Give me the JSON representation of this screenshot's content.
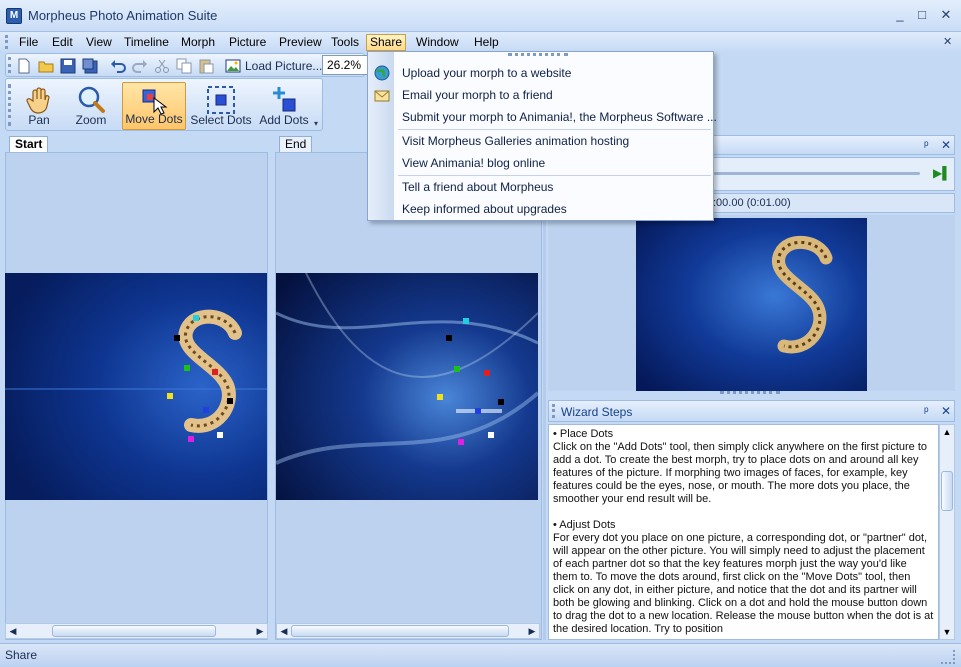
{
  "app": {
    "title": "Morpheus Photo Animation Suite",
    "window_minimize": "_",
    "window_restore": "□",
    "window_close": "✕"
  },
  "menubar": {
    "items": [
      "File",
      "Edit",
      "View",
      "Timeline",
      "Morph",
      "Picture",
      "Preview",
      "Tools",
      "Share",
      "Window",
      "Help"
    ],
    "active": "Share",
    "right_close": "✕"
  },
  "toolbar": {
    "load_picture_label": "Load Picture...",
    "zoom_value": "26.2%"
  },
  "tools": {
    "items": [
      "Pan",
      "Zoom",
      "Move Dots",
      "Select Dots",
      "Add Dots"
    ],
    "active": "Move Dots"
  },
  "start_panel": {
    "tab_label": "Start"
  },
  "end_panel": {
    "tab_label": "End"
  },
  "preview_panel": {
    "time_readout": ":00.00 (0:01.00)"
  },
  "share_menu": {
    "items": [
      "Upload your morph to a website",
      "Email your morph to a friend",
      "Submit your morph to Animania!, the Morpheus Software ...",
      "Visit Morpheus Galleries animation hosting",
      "View Animania! blog online",
      "Tell a friend about Morpheus",
      "Keep informed about upgrades"
    ]
  },
  "wizard": {
    "title": "Wizard Steps",
    "sections": [
      {
        "heading": "• Place Dots",
        "body": "Click on the \"Add Dots\" tool, then simply click anywhere on the first picture to add a dot.  To create the best morph, try to place dots on and around all key features of the picture.  If morphing two images of faces, for example, key features could be the eyes, nose, or mouth.  The more dots you place, the smoother your end result will be."
      },
      {
        "heading": "• Adjust Dots",
        "body": "For every dot you place on one picture, a corresponding dot, or \"partner\" dot, will appear on the other picture.  You will simply need to adjust the placement of each partner dot so that the key features morph just the way you'd like them to.  To move the dots around, first click on the \"Move Dots\" tool, then click on any dot, in either picture, and notice that the dot and its partner will both be glowing and blinking.  Click on a dot and hold the mouse button down to drag the dot to a new location.  Release the mouse button when the dot is at the desired location.  Try to position"
      }
    ]
  },
  "statusbar": {
    "text": "Share"
  },
  "colors": {
    "app_bg": "#c4daf4",
    "accent_active": "#ffc56a",
    "photo_dark_blue": "#0a2a78"
  }
}
